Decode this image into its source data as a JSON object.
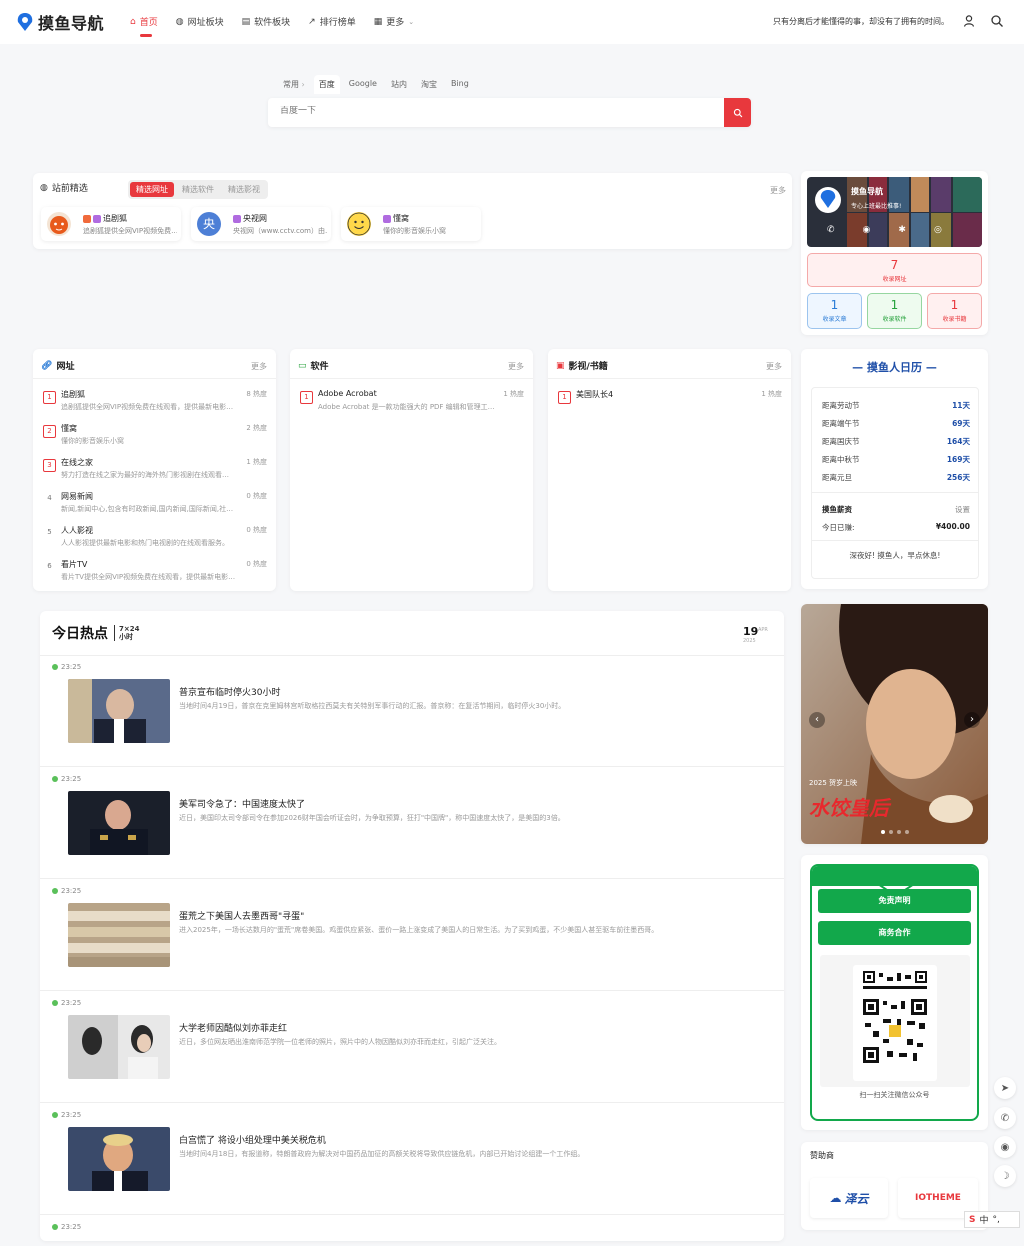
{
  "brand": {
    "name": "摸鱼导航"
  },
  "nav": [
    {
      "label": "首页",
      "icon": "home-icon",
      "active": true
    },
    {
      "label": "网址板块",
      "icon": "globe-icon"
    },
    {
      "label": "软件板块",
      "icon": "box-icon"
    },
    {
      "label": "排行榜单",
      "icon": "trend-icon"
    },
    {
      "label": "更多",
      "icon": "grid-icon"
    }
  ],
  "slogan": "只有分离后才能懂得的事，却没有了拥有的时间。",
  "search": {
    "tabs": [
      "常用",
      "百度",
      "Google",
      "站内",
      "淘宝",
      "Bing"
    ],
    "placeholder": "百度一下"
  },
  "picks": {
    "title": "站前精选",
    "tabs": [
      "精选网址",
      "精选软件",
      "精选影视"
    ],
    "more": "更多",
    "items": [
      {
        "name": "追剧狐",
        "desc": "追剧狐提供全网VIP视频免费…"
      },
      {
        "name": "央视网",
        "desc": "央视网（www.cctv.com）由…"
      },
      {
        "name": "懂窝",
        "desc": "懂你的影音娱乐小窝"
      }
    ]
  },
  "profile": {
    "name": "摸鱼导航",
    "subtitle": "专心上班最比推事!",
    "stats": [
      {
        "num": "7",
        "label": "收录网址"
      },
      {
        "num": "1",
        "label": "收录文章"
      },
      {
        "num": "1",
        "label": "收录软件"
      },
      {
        "num": "1",
        "label": "收录书籍"
      }
    ]
  },
  "categories": [
    {
      "title": "网址",
      "more": "更多",
      "rows": [
        {
          "n": "1",
          "t": "追剧狐",
          "d": "追剧狐提供全网VIP视频免费在线观看，提供最新电影…",
          "h": "8 热度"
        },
        {
          "n": "2",
          "t": "懂窝",
          "d": "懂你的影音娱乐小窝",
          "h": "2 热度"
        },
        {
          "n": "3",
          "t": "在线之家",
          "d": "努力打造在线之家为最好的海外热门影视剧在线观看…",
          "h": "1 热度"
        },
        {
          "n": "4",
          "t": "网易新闻",
          "d": "新闻,新闻中心,包含有时政新闻,国内新闻,国际新闻,社…",
          "h": "0 热度"
        },
        {
          "n": "5",
          "t": "人人影视",
          "d": "人人影视提供最新电影和热门电视剧的在线观看服务。",
          "h": "0 热度"
        },
        {
          "n": "6",
          "t": "看片TV",
          "d": "看片TV提供全网VIP视频免费在线观看，提供最新电影…",
          "h": "0 热度"
        }
      ]
    },
    {
      "title": "软件",
      "more": "更多",
      "rows": [
        {
          "n": "1",
          "t": "Adobe Acrobat",
          "d": "Adobe Acrobat 是一款功能强大的 PDF 编辑和管理工…",
          "h": "1 热度"
        }
      ]
    },
    {
      "title": "影视/书籍",
      "more": "更多",
      "rows": [
        {
          "n": "1",
          "t": "美国队长4",
          "d": "",
          "h": "1 热度"
        }
      ]
    }
  ],
  "calendar": {
    "title": "— 摸鱼人日历 —",
    "rows": [
      {
        "l": "距离劳动节",
        "v": "11天"
      },
      {
        "l": "距离端午节",
        "v": "69天"
      },
      {
        "l": "距离国庆节",
        "v": "164天"
      },
      {
        "l": "距离中秋节",
        "v": "169天"
      },
      {
        "l": "距离元旦",
        "v": "256天"
      }
    ],
    "salary_title": "摸鱼薪资",
    "salary_set": "设置",
    "earned_label": "今日已赚:",
    "earned": "¥400.00",
    "note": "深夜好! 摸鱼人，早点休息!"
  },
  "hot": {
    "title": "今日热点",
    "badge": "7×24",
    "badge2": "小时",
    "day": "19",
    "month": "APR",
    "year": "2025",
    "items": [
      {
        "time": "23:25",
        "title": "普京宣布临时停火30小时",
        "desc": "当地时间4月19日，普京在克里姆林宫听取格拉西莫夫有关特别军事行动的汇报。普京称：在复活节期间，临时停火30小时。"
      },
      {
        "time": "23:25",
        "title": "美军司令急了：中国速度太快了",
        "desc": "近日，美国印太司令部司令在参加2026财年国会听证会时，为争取预算，狂打\"中国牌\"，称中国速度太快了，是美国的3倍。"
      },
      {
        "time": "23:25",
        "title": "蛋荒之下美国人去墨西哥\"寻蛋\"",
        "desc": "进入2025年，一场长达数月的\"蛋荒\"席卷美国。鸡蛋供应紧张、蛋价一路上涨变成了美国人的日常生活。为了买到鸡蛋，不少美国人甚至驱车前往墨西哥。"
      },
      {
        "time": "23:25",
        "title": "大学老师因酷似刘亦菲走红",
        "desc": "近日，多位网友晒出淮南师范学院一位老师的照片，照片中的人物因酷似刘亦菲而走红，引起广泛关注。"
      },
      {
        "time": "23:25",
        "title": "白宫慌了 将设小组处理中美关税危机",
        "desc": "当地时间4月18日，有报道称，特朗普政府为解决对中国药品加征的高额关税将导致供应链危机，内部已开始讨论组建一个工作组。"
      },
      {
        "time": "23:25",
        "title": "",
        "desc": ""
      }
    ]
  },
  "poster": {
    "text": "2025 贺岁上映",
    "title": "水饺皇后"
  },
  "wx": {
    "btn1": "免责声明",
    "btn2": "商务合作",
    "caption": "扫一扫关注微信公众号"
  },
  "sponsor": {
    "title": "赞助商",
    "s1": "泽云",
    "s2": "IOTHEME"
  },
  "colors": {
    "accent": "#e8383d",
    "blue": "#1f4fa8",
    "green": "#12a84b"
  }
}
